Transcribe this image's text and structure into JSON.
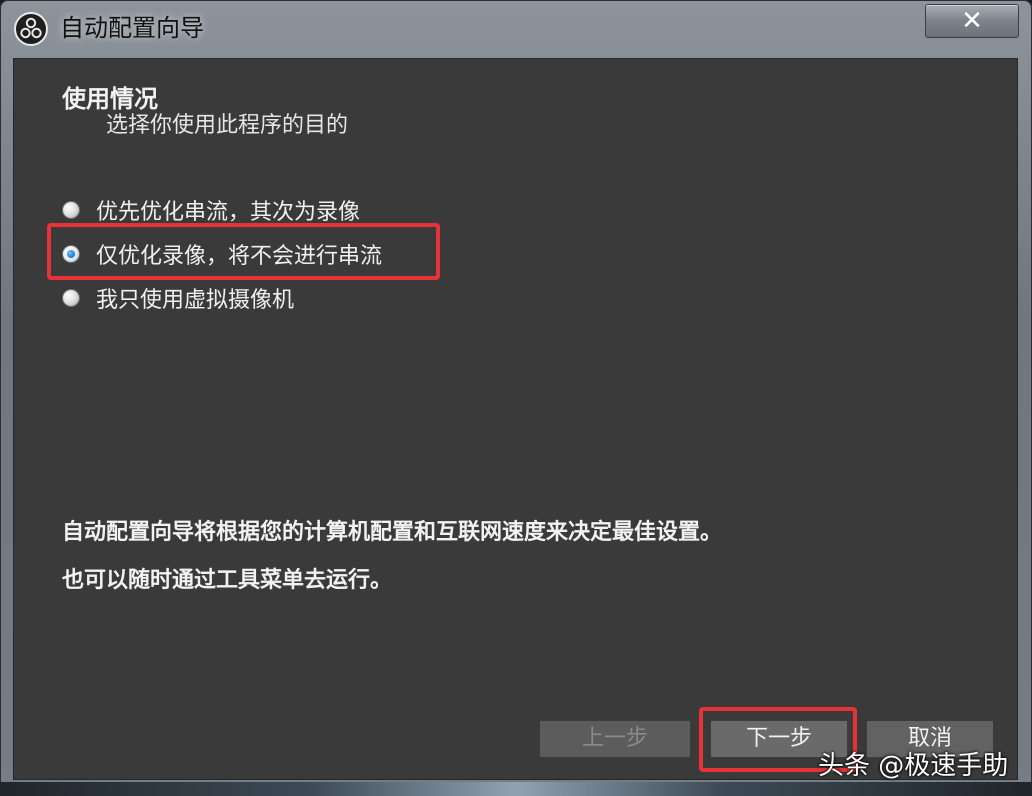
{
  "window": {
    "title": "自动配置向导",
    "close_label": "✕"
  },
  "content": {
    "heading": "使用情况",
    "subheading": "选择你使用此程序的目的",
    "options": [
      {
        "label": "优先优化串流，其次为录像",
        "checked": false
      },
      {
        "label": "仅优化录像，将不会进行串流",
        "checked": true
      },
      {
        "label": "我只使用虚拟摄像机",
        "checked": false
      }
    ],
    "info_lines": [
      "自动配置向导将根据您的计算机配置和互联网速度来决定最佳设置。",
      "也可以随时通过工具菜单去运行。"
    ]
  },
  "buttons": {
    "prev": "上一步",
    "next": "下一步",
    "cancel": "取消"
  },
  "watermark": "头条 @极速手助",
  "colors": {
    "highlight": "#e8323a",
    "client_bg": "#3a3a3a",
    "radio_selected": "#1c78c8"
  }
}
